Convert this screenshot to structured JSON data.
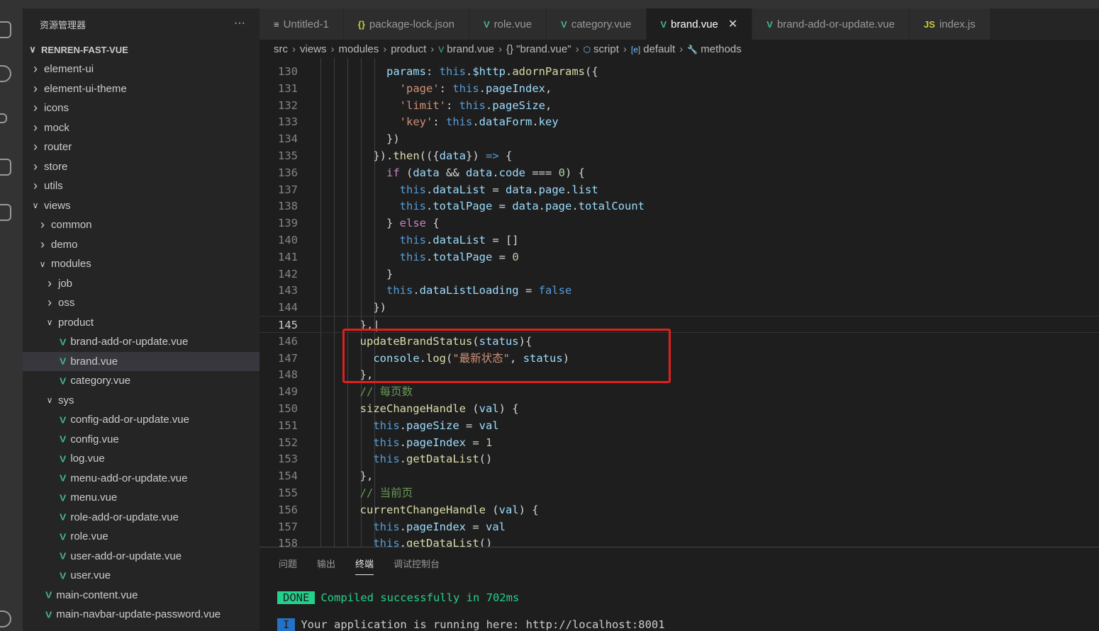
{
  "sidebar": {
    "title": "资源管理器",
    "more": "···",
    "root": "RENREN-FAST-VUE",
    "items": [
      {
        "label": "element-ui",
        "depth": 1,
        "type": "folder",
        "open": false
      },
      {
        "label": "element-ui-theme",
        "depth": 1,
        "type": "folder",
        "open": false
      },
      {
        "label": "icons",
        "depth": 1,
        "type": "folder",
        "open": false
      },
      {
        "label": "mock",
        "depth": 1,
        "type": "folder",
        "open": false
      },
      {
        "label": "router",
        "depth": 1,
        "type": "folder",
        "open": false
      },
      {
        "label": "store",
        "depth": 1,
        "type": "folder",
        "open": false
      },
      {
        "label": "utils",
        "depth": 1,
        "type": "folder",
        "open": false
      },
      {
        "label": "views",
        "depth": 1,
        "type": "folder",
        "open": true
      },
      {
        "label": "common",
        "depth": 2,
        "type": "folder",
        "open": false
      },
      {
        "label": "demo",
        "depth": 2,
        "type": "folder",
        "open": false
      },
      {
        "label": "modules",
        "depth": 2,
        "type": "folder",
        "open": true
      },
      {
        "label": "job",
        "depth": 3,
        "type": "folder",
        "open": false
      },
      {
        "label": "oss",
        "depth": 3,
        "type": "folder",
        "open": false
      },
      {
        "label": "product",
        "depth": 3,
        "type": "folder",
        "open": true
      },
      {
        "label": "brand-add-or-update.vue",
        "depth": 4,
        "type": "vue"
      },
      {
        "label": "brand.vue",
        "depth": 4,
        "type": "vue",
        "selected": true
      },
      {
        "label": "category.vue",
        "depth": 4,
        "type": "vue"
      },
      {
        "label": "sys",
        "depth": 3,
        "type": "folder",
        "open": true
      },
      {
        "label": "config-add-or-update.vue",
        "depth": 4,
        "type": "vue"
      },
      {
        "label": "config.vue",
        "depth": 4,
        "type": "vue"
      },
      {
        "label": "log.vue",
        "depth": 4,
        "type": "vue"
      },
      {
        "label": "menu-add-or-update.vue",
        "depth": 4,
        "type": "vue"
      },
      {
        "label": "menu.vue",
        "depth": 4,
        "type": "vue"
      },
      {
        "label": "role-add-or-update.vue",
        "depth": 4,
        "type": "vue"
      },
      {
        "label": "role.vue",
        "depth": 4,
        "type": "vue"
      },
      {
        "label": "user-add-or-update.vue",
        "depth": 4,
        "type": "vue"
      },
      {
        "label": "user.vue",
        "depth": 4,
        "type": "vue"
      },
      {
        "label": "main-content.vue",
        "depth": 2,
        "type": "vue"
      },
      {
        "label": "main-navbar-update-password.vue",
        "depth": 2,
        "type": "vue"
      }
    ]
  },
  "tabs": [
    {
      "label": "Untitled-1",
      "icon": "≡",
      "icon_color": "#c5c5c5"
    },
    {
      "label": "package-lock.json",
      "icon": "{}",
      "icon_color": "#cbcb41"
    },
    {
      "label": "role.vue",
      "icon": "V",
      "icon_color": "#41b883"
    },
    {
      "label": "category.vue",
      "icon": "V",
      "icon_color": "#41b883"
    },
    {
      "label": "brand.vue",
      "icon": "V",
      "icon_color": "#41b883",
      "active": true,
      "close": "✕"
    },
    {
      "label": "brand-add-or-update.vue",
      "icon": "V",
      "icon_color": "#41b883"
    },
    {
      "label": "index.js",
      "icon": "JS",
      "icon_color": "#cbcb41"
    }
  ],
  "breadcrumbs": [
    "src",
    "views",
    "modules",
    "product",
    "brand.vue",
    "{} \"brand.vue\"",
    "script",
    "default",
    "methods"
  ],
  "editor": {
    "current_line": 145,
    "lines": [
      {
        "n": 130,
        "i": 12,
        "t": [
          [
            "pr",
            "params"
          ],
          [
            "pl",
            ": "
          ],
          [
            "kw",
            "this"
          ],
          [
            "pl",
            "."
          ],
          [
            "pr",
            "$http"
          ],
          [
            "pl",
            "."
          ],
          [
            "fn",
            "adornParams"
          ],
          [
            "pl",
            "({"
          ]
        ]
      },
      {
        "n": 131,
        "i": 14,
        "t": [
          [
            "st",
            "'page'"
          ],
          [
            "pl",
            ": "
          ],
          [
            "kw",
            "this"
          ],
          [
            "pl",
            "."
          ],
          [
            "pr",
            "pageIndex"
          ],
          [
            "pl",
            ","
          ]
        ]
      },
      {
        "n": 132,
        "i": 14,
        "t": [
          [
            "st",
            "'limit'"
          ],
          [
            "pl",
            ": "
          ],
          [
            "kw",
            "this"
          ],
          [
            "pl",
            "."
          ],
          [
            "pr",
            "pageSize"
          ],
          [
            "pl",
            ","
          ]
        ]
      },
      {
        "n": 133,
        "i": 14,
        "t": [
          [
            "st",
            "'key'"
          ],
          [
            "pl",
            ": "
          ],
          [
            "kw",
            "this"
          ],
          [
            "pl",
            "."
          ],
          [
            "pr",
            "dataForm"
          ],
          [
            "pl",
            "."
          ],
          [
            "pr",
            "key"
          ]
        ]
      },
      {
        "n": 134,
        "i": 12,
        "t": [
          [
            "pl",
            "})"
          ]
        ]
      },
      {
        "n": 135,
        "i": 10,
        "t": [
          [
            "pl",
            "})."
          ],
          [
            "fn",
            "then"
          ],
          [
            "pl",
            "(({"
          ],
          [
            "pr",
            "data"
          ],
          [
            "pl",
            "}) "
          ],
          [
            "kw",
            "=>"
          ],
          [
            "pl",
            " {"
          ]
        ]
      },
      {
        "n": 136,
        "i": 12,
        "t": [
          [
            "ctl",
            "if"
          ],
          [
            "pl",
            " ("
          ],
          [
            "pr",
            "data"
          ],
          [
            "pl",
            " && "
          ],
          [
            "pr",
            "data"
          ],
          [
            "pl",
            "."
          ],
          [
            "pr",
            "code"
          ],
          [
            "pl",
            " === "
          ],
          [
            "nu",
            "0"
          ],
          [
            "pl",
            ") {"
          ]
        ]
      },
      {
        "n": 137,
        "i": 14,
        "t": [
          [
            "kw",
            "this"
          ],
          [
            "pl",
            "."
          ],
          [
            "pr",
            "dataList"
          ],
          [
            "pl",
            " = "
          ],
          [
            "pr",
            "data"
          ],
          [
            "pl",
            "."
          ],
          [
            "pr",
            "page"
          ],
          [
            "pl",
            "."
          ],
          [
            "pr",
            "list"
          ]
        ]
      },
      {
        "n": 138,
        "i": 14,
        "t": [
          [
            "kw",
            "this"
          ],
          [
            "pl",
            "."
          ],
          [
            "pr",
            "totalPage"
          ],
          [
            "pl",
            " = "
          ],
          [
            "pr",
            "data"
          ],
          [
            "pl",
            "."
          ],
          [
            "pr",
            "page"
          ],
          [
            "pl",
            "."
          ],
          [
            "pr",
            "totalCount"
          ]
        ]
      },
      {
        "n": 139,
        "i": 12,
        "t": [
          [
            "pl",
            "} "
          ],
          [
            "ctl",
            "else"
          ],
          [
            "pl",
            " {"
          ]
        ]
      },
      {
        "n": 140,
        "i": 14,
        "t": [
          [
            "kw",
            "this"
          ],
          [
            "pl",
            "."
          ],
          [
            "pr",
            "dataList"
          ],
          [
            "pl",
            " = []"
          ]
        ]
      },
      {
        "n": 141,
        "i": 14,
        "t": [
          [
            "kw",
            "this"
          ],
          [
            "pl",
            "."
          ],
          [
            "pr",
            "totalPage"
          ],
          [
            "pl",
            " = "
          ],
          [
            "nu",
            "0"
          ]
        ]
      },
      {
        "n": 142,
        "i": 12,
        "t": [
          [
            "pl",
            "}"
          ]
        ]
      },
      {
        "n": 143,
        "i": 12,
        "t": [
          [
            "kw",
            "this"
          ],
          [
            "pl",
            "."
          ],
          [
            "pr",
            "dataListLoading"
          ],
          [
            "pl",
            " = "
          ],
          [
            "kw",
            "false"
          ]
        ]
      },
      {
        "n": 144,
        "i": 10,
        "t": [
          [
            "pl",
            "})"
          ]
        ]
      },
      {
        "n": 145,
        "i": 8,
        "t": [
          [
            "pl",
            "},|"
          ]
        ]
      },
      {
        "n": 146,
        "i": 8,
        "t": [
          [
            "fn",
            "updateBrandStatus"
          ],
          [
            "pl",
            "("
          ],
          [
            "pr",
            "status"
          ],
          [
            "pl",
            "){"
          ]
        ]
      },
      {
        "n": 147,
        "i": 10,
        "t": [
          [
            "pr",
            "console"
          ],
          [
            "pl",
            "."
          ],
          [
            "fn",
            "log"
          ],
          [
            "pl",
            "("
          ],
          [
            "st",
            "\"最新状态\""
          ],
          [
            "pl",
            ", "
          ],
          [
            "pr",
            "status"
          ],
          [
            "pl",
            ")"
          ]
        ]
      },
      {
        "n": 148,
        "i": 8,
        "t": [
          [
            "pl",
            "},"
          ]
        ]
      },
      {
        "n": 149,
        "i": 8,
        "t": [
          [
            "cm",
            "// 每页数"
          ]
        ]
      },
      {
        "n": 150,
        "i": 8,
        "t": [
          [
            "fn",
            "sizeChangeHandle"
          ],
          [
            "pl",
            " ("
          ],
          [
            "pr",
            "val"
          ],
          [
            "pl",
            ") {"
          ]
        ]
      },
      {
        "n": 151,
        "i": 10,
        "t": [
          [
            "kw",
            "this"
          ],
          [
            "pl",
            "."
          ],
          [
            "pr",
            "pageSize"
          ],
          [
            "pl",
            " = "
          ],
          [
            "pr",
            "val"
          ]
        ]
      },
      {
        "n": 152,
        "i": 10,
        "t": [
          [
            "kw",
            "this"
          ],
          [
            "pl",
            "."
          ],
          [
            "pr",
            "pageIndex"
          ],
          [
            "pl",
            " = "
          ],
          [
            "nu",
            "1"
          ]
        ]
      },
      {
        "n": 153,
        "i": 10,
        "t": [
          [
            "kw",
            "this"
          ],
          [
            "pl",
            "."
          ],
          [
            "fn",
            "getDataList"
          ],
          [
            "pl",
            "()"
          ]
        ]
      },
      {
        "n": 154,
        "i": 8,
        "t": [
          [
            "pl",
            "},"
          ]
        ]
      },
      {
        "n": 155,
        "i": 8,
        "t": [
          [
            "cm",
            "// 当前页"
          ]
        ]
      },
      {
        "n": 156,
        "i": 8,
        "t": [
          [
            "fn",
            "currentChangeHandle"
          ],
          [
            "pl",
            " ("
          ],
          [
            "pr",
            "val"
          ],
          [
            "pl",
            ") {"
          ]
        ]
      },
      {
        "n": 157,
        "i": 10,
        "t": [
          [
            "kw",
            "this"
          ],
          [
            "pl",
            "."
          ],
          [
            "pr",
            "pageIndex"
          ],
          [
            "pl",
            " = "
          ],
          [
            "pr",
            "val"
          ]
        ]
      },
      {
        "n": 158,
        "i": 10,
        "t": [
          [
            "kw",
            "this"
          ],
          [
            "pl",
            "."
          ],
          [
            "fn",
            "getDataList"
          ],
          [
            "pl",
            "()"
          ]
        ]
      }
    ]
  },
  "panel": {
    "tabs": [
      "问题",
      "输出",
      "终端",
      "调试控制台"
    ],
    "active_tab": "终端",
    "terminal": [
      {
        "badge": "DONE",
        "badge_color": "#23d18b",
        "text": "Compiled successfully in 702ms",
        "text_color": "#23d18b"
      },
      {
        "badge": "I",
        "badge_color": "#2472c8",
        "text": "Your application is running here: http://localhost:8001",
        "text_color": "#cccccc"
      }
    ]
  }
}
